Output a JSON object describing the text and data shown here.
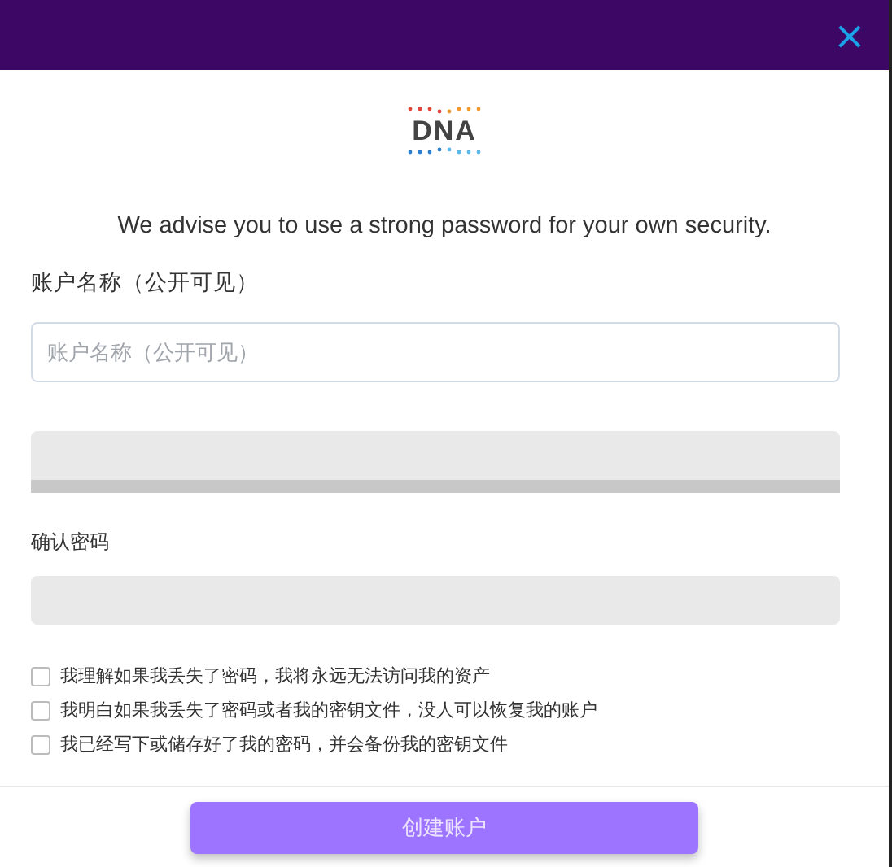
{
  "header": {
    "close": "×"
  },
  "logo": {
    "text": "DNA"
  },
  "intro": "We advise you to use a strong password for your own security.",
  "account_name": {
    "label": "账户名称（公开可见）",
    "placeholder": "账户名称（公开可见）"
  },
  "confirm_password": {
    "label": "确认密码"
  },
  "agreements": [
    {
      "text": "我理解如果我丢失了密码，我将永远无法访问我的资产",
      "checked": false
    },
    {
      "text": "我明白如果我丢失了密码或者我的密钥文件，没人可以恢复我的账户",
      "checked": false
    },
    {
      "text": "我已经写下或储存好了我的密码，并会备份我的密钥文件",
      "checked": false
    }
  ],
  "create_button": {
    "label": "创建账户",
    "disabled": true
  }
}
